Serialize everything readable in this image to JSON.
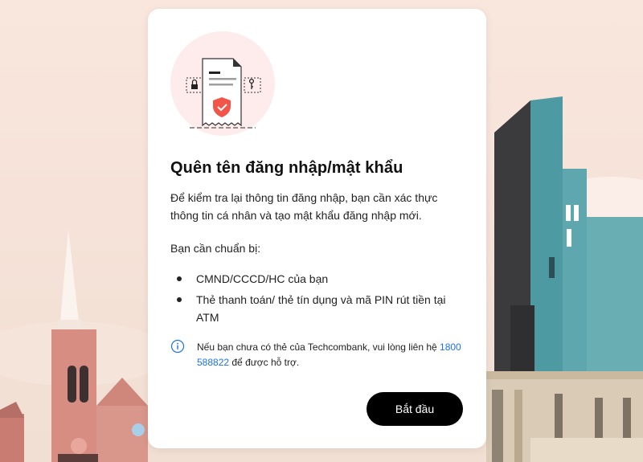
{
  "modal": {
    "title": "Quên tên đăng nhập/mật khẩu",
    "description": "Để kiểm tra lại thông tin đăng nhập, bạn cần xác thực thông tin cá nhân và tạo mật khẩu đăng nhập mới.",
    "prepare_heading": "Bạn cần chuẩn bị:",
    "requirements": [
      "CMND/CCCD/HC của bạn",
      "Thẻ thanh toán/ thẻ tín dụng và mã PIN rút tiền tại ATM"
    ],
    "note_prefix": "Nếu bạn chưa có thẻ của Techcombank, vui lòng liên hệ ",
    "note_phone": "1800 588822",
    "note_suffix": " để được hỗ trợ.",
    "start_button": "Bắt đầu"
  },
  "colors": {
    "accent_link": "#1a73e8",
    "button_bg": "#000000",
    "illustration_circle": "#fdeceb",
    "shield_red": "#f2564a"
  },
  "icons": [
    "document-shield-illustration",
    "info-icon",
    "lock-icon",
    "key-icon"
  ]
}
